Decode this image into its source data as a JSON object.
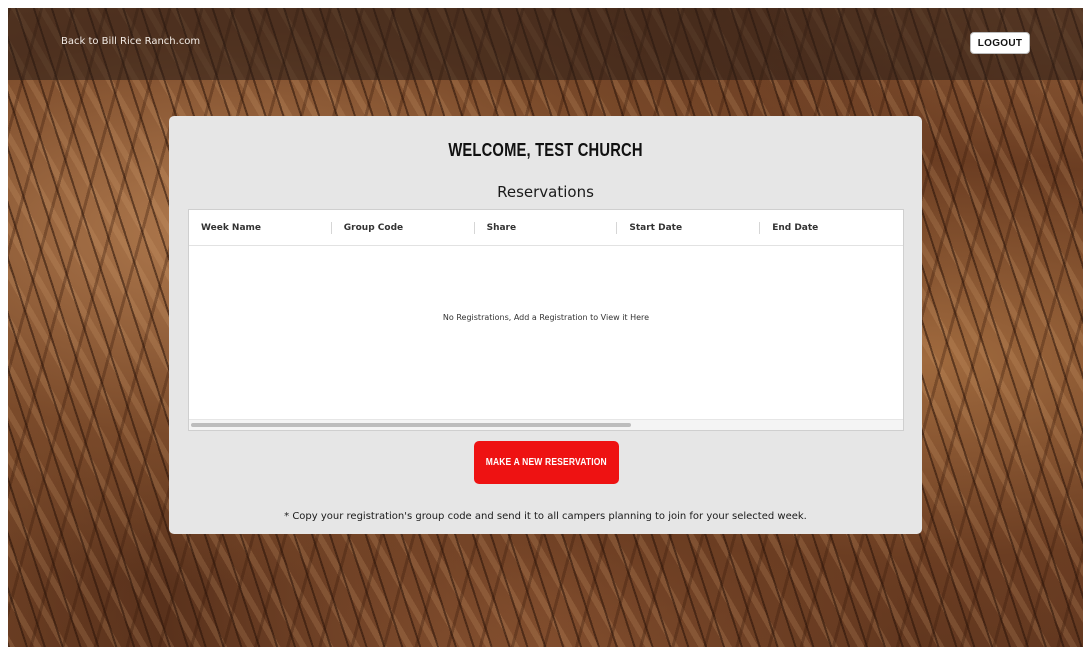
{
  "header": {
    "back_link_label": "Back to Bill Rice Ranch.com",
    "logout_label": "LOGOUT"
  },
  "main": {
    "welcome_title": "WELCOME, TEST CHURCH",
    "section_title": "Reservations",
    "table": {
      "columns": [
        "Week Name",
        "Group Code",
        "Share",
        "Start Date",
        "End Date"
      ],
      "rows": [],
      "empty_message": "No Registrations, Add a Registration to View it Here"
    },
    "make_reservation_label": "MAKE A NEW RESERVATION",
    "footnote": "* Copy your registration's group code and send it to all campers planning to join for your selected week."
  },
  "colors": {
    "accent_button": "#ee1212",
    "card_background": "#e6e6e6",
    "topbar_overlay": "rgba(40,28,22,0.55)"
  }
}
